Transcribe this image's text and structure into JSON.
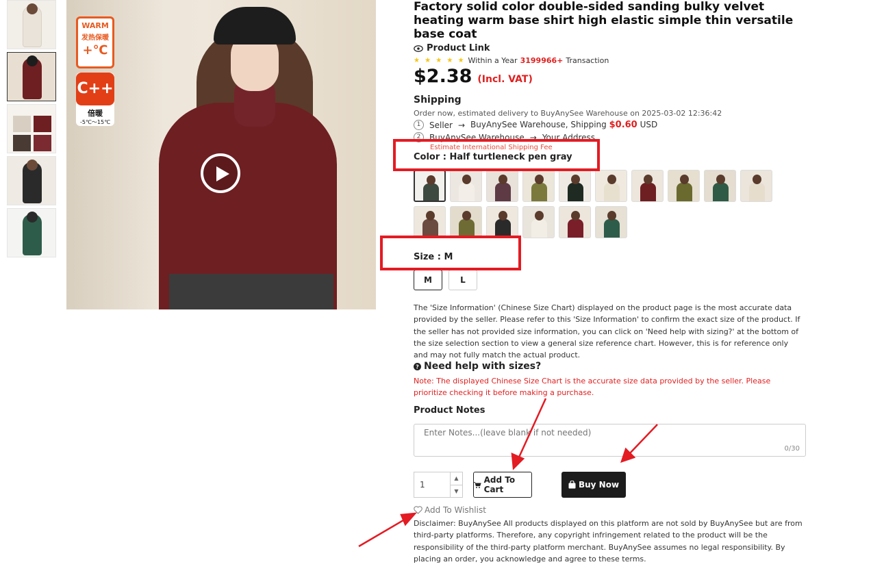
{
  "product": {
    "title": "Factory solid color double-sided sanding bulky velvet heating warm base shirt high elastic simple thin versatile base coat",
    "product_link": "Product Link",
    "rating_stars": "★ ★ ★ ★ ★",
    "within_year": "Within a Year",
    "transactions": "3199966+",
    "transaction_label": "Transaction",
    "price": "$2.38",
    "vat": "(Incl. VAT)"
  },
  "image_badges": {
    "warm_title": "WARM",
    "warm_cn": "发热保暖",
    "warm_temp": "+℃",
    "boost_symbol": "C++",
    "boost_cn": "倍暖",
    "boost_range": "-5℃～15℃"
  },
  "shipping": {
    "heading": "Shipping",
    "estimate": "Order now, estimated delivery to BuyAnySee Warehouse on 2025-03-02 12:36:42",
    "step1_num": "1",
    "step1_from": "Seller",
    "step1_to": "BuyAnySee Warehouse, Shipping",
    "step1_fee": "$0.60",
    "step1_currency": "USD",
    "step2_num": "2",
    "step2_from": "BuyAnySee Warehouse",
    "step2_to": "Your Address",
    "intl_fee": "Estimate International Shipping Fee"
  },
  "color": {
    "label": "Color : Half turtleneck pen gray",
    "swatches": [
      {
        "color": "#3d4a3f",
        "bg": "#f3f1ed"
      },
      {
        "color": "#f3efe8",
        "bg": "#ece7e0"
      },
      {
        "color": "#5e3a44",
        "bg": "#e8e2da"
      },
      {
        "color": "#7b7a3c",
        "bg": "#ece6da"
      },
      {
        "color": "#1e2a22",
        "bg": "#eeeae3"
      },
      {
        "color": "#e8e0cf",
        "bg": "#efe9df"
      },
      {
        "color": "#6e1f22",
        "bg": "#ece6dc"
      },
      {
        "color": "#6a6a2e",
        "bg": "#e6dfcf"
      },
      {
        "color": "#2f5a46",
        "bg": "#e4ddd0"
      },
      {
        "color": "#e6ddcd",
        "bg": "#ebe5db"
      },
      {
        "color": "#6b4a3f",
        "bg": "#ede7dd"
      },
      {
        "color": "#6f6b34",
        "bg": "#e3dccc"
      },
      {
        "color": "#2a2a2a",
        "bg": "#eee8df"
      },
      {
        "color": "#f2eee6",
        "bg": "#e9e4dc"
      },
      {
        "color": "#7a1e2a",
        "bg": "#ece6dc"
      },
      {
        "color": "#2e5c4a",
        "bg": "#e6e0d5"
      }
    ]
  },
  "size": {
    "label": "Size : M",
    "options": [
      "M",
      "L"
    ],
    "info": "The 'Size Information' (Chinese Size Chart) displayed on the product page is the most accurate data provided by the seller. Please refer to this 'Size Information' to confirm the exact size of the product. If the seller has not provided size information, you can click on 'Need help with sizing?' at the bottom of the size selection section to view a general size reference chart. However, this is for reference only and may not fully match the actual product.",
    "help": "Need help with sizes?",
    "note": "Note: The displayed Chinese Size Chart is the accurate size data provided by the seller. Please prioritize checking it before making a purchase."
  },
  "notes": {
    "label": "Product Notes",
    "placeholder": "Enter Notes...(leave blank if not needed)",
    "counter": "0/30"
  },
  "purchase": {
    "quantity": "1",
    "add_to_cart": "Add To Cart",
    "buy_now": "Buy Now",
    "wishlist": "Add To Wishlist"
  },
  "disclaimer": "Disclaimer: BuyAnySee All products displayed on this platform are not sold by BuyAnySee but are from third-party platforms. Therefore, any copyright infringement related to the product will be the responsibility of the third-party platform merchant. BuyAnySee assumes no legal responsibility. By placing an order, you acknowledge and agree to these terms.",
  "thumbnails": [
    {
      "color": "#e9e3da"
    },
    {
      "color": "#6e1f22"
    },
    {
      "color": "#d8cfc2"
    },
    {
      "color": "#2a2a2a"
    },
    {
      "color": "#2e5c4a"
    }
  ],
  "colors": {
    "accent_red": "#e02020",
    "annotation_red": "#e31b23",
    "button_dark": "#1c1c1c",
    "star_yellow": "#f5c518"
  }
}
